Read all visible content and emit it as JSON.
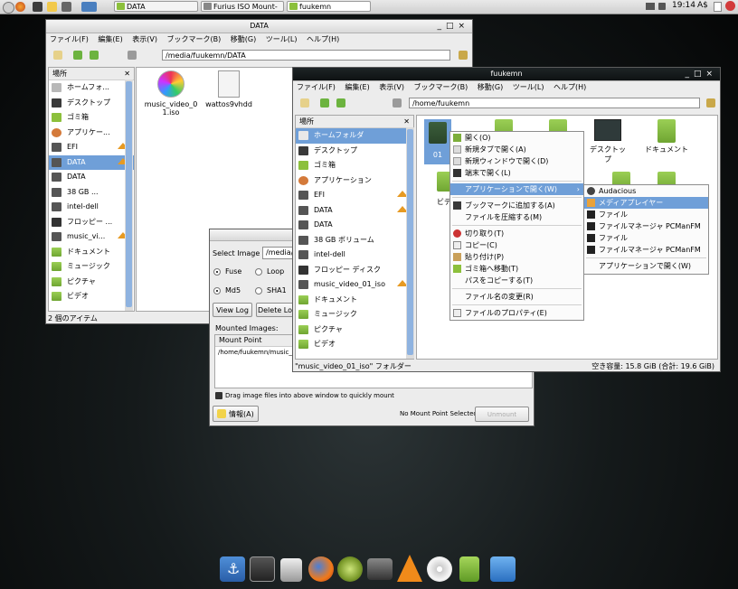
{
  "top_panel": {
    "tasks": [
      "DATA",
      "Furius ISO Mount-",
      "fuukemn"
    ],
    "clock": "19:14",
    "indicator": "A$"
  },
  "data_window": {
    "title": "DATA",
    "menu": [
      "ファイル(F)",
      "編集(E)",
      "表示(V)",
      "ブックマーク(B)",
      "移動(G)",
      "ツール(L)",
      "ヘルプ(H)"
    ],
    "address": "/media/fuukemn/DATA",
    "sidebar_header": "場所",
    "sidebar_items": [
      "ホームフォ...",
      "デスクトップ",
      "ゴミ箱",
      "アプリケー...",
      "EFI",
      "DATA",
      "DATA",
      "38 GB ...",
      "intel-dell",
      "フロッピー ...",
      "music_vi...",
      "ドキュメント",
      "ミュージック",
      "ピクチャ",
      "ビデオ"
    ],
    "files": [
      "music_video_01.iso",
      "wattos9vhdd"
    ],
    "status": "2 個のアイテム"
  },
  "furius_window": {
    "select_image_label": "Select Image",
    "image_value": "/media/",
    "fuse": "Fuse",
    "loop": "Loop",
    "md5": "Md5",
    "sha1": "SHA1",
    "view_log": "View Log",
    "delete_log": "Delete Lo",
    "mounted_images": "Mounted Images:",
    "mount_point_header": "Mount Point",
    "mount_point_row": "/home/fuukemn/music_",
    "hint": "Drag image files into above window to quickly mount",
    "info_button": "情報(A)",
    "no_mount": "No Mount Point Selected",
    "unmount": "Unmount"
  },
  "home_window": {
    "title": "fuukemn",
    "menu": [
      "ファイル(F)",
      "編集(E)",
      "表示(V)",
      "ブックマーク(B)",
      "移動(G)",
      "ツール(L)",
      "ヘルプ(H)"
    ],
    "address": "/home/fuukemn",
    "sidebar_header": "場所",
    "sidebar_items": [
      "ホームフォルダ",
      "デスクトップ",
      "ゴミ箱",
      "アプリケーション",
      "EFI",
      "DATA",
      "DATA",
      "38 GB ボリューム",
      "intel-dell",
      "フロッピー ディスク",
      "music_video_01_iso",
      "ドキュメント",
      "ミュージック",
      "ピクチャ",
      "ビデオ"
    ],
    "files": [
      "デスクトップ",
      "ドキュメント"
    ],
    "selected_file_fragment": "01",
    "partial_label": "ビデ",
    "status_left": "\"music_video_01_iso\" フォルダー",
    "status_right": "空き容量: 15.8 GiB (合計: 19.6 GiB)"
  },
  "context_menu": {
    "items": [
      "開く(O)",
      "新規タブで開く(A)",
      "新規ウィンドウで開く(D)",
      "端末で開く(L)",
      "アプリケーションで開く(W)",
      "ブックマークに追加する(A)",
      "ファイルを圧縮する(M)",
      "切り取り(T)",
      "コピー(C)",
      "貼り付け(P)",
      "ゴミ箱へ移動(T)",
      "パスをコピーする(T)",
      "ファイル名の変更(R)",
      "ファイルのプロパティ(E)"
    ]
  },
  "submenu": {
    "items": [
      "Audacious",
      "メディアプレイヤー",
      "ファイル",
      "ファイルマネージャ PCManFM",
      "ファイル",
      "ファイルマネージャ PCManFM",
      "アプリケーションで開く(W)"
    ]
  },
  "dock": {
    "icons": [
      "anchor-icon",
      "monitor-icon",
      "drive-icon",
      "firefox-icon",
      "media-icon",
      "camera-icon",
      "vlc-icon",
      "disc-icon",
      "trash-icon",
      "window-icon"
    ]
  }
}
